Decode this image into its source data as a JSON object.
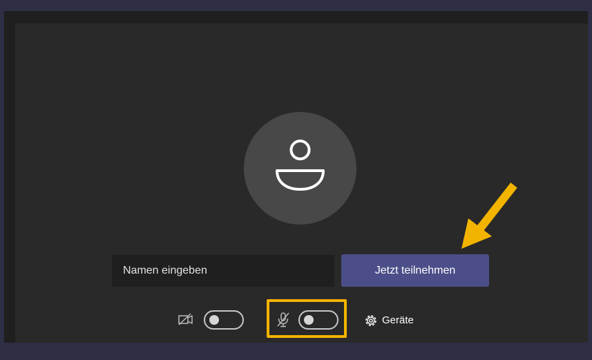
{
  "prejoin": {
    "name_placeholder": "Namen eingeben",
    "name_value": "",
    "join_label": "Jetzt teilnehmen",
    "devices_label": "Geräte"
  },
  "icons": {
    "avatar": "person-icon",
    "camera": "camera-off-icon",
    "microphone": "mic-off-icon",
    "settings": "gear-icon"
  },
  "toggles": {
    "camera_on": false,
    "microphone_on": false
  },
  "colors": {
    "join_button": "#4b4e88",
    "highlight": "#f3b400",
    "panel": "#292929",
    "input_bg": "#1f1f1f"
  }
}
